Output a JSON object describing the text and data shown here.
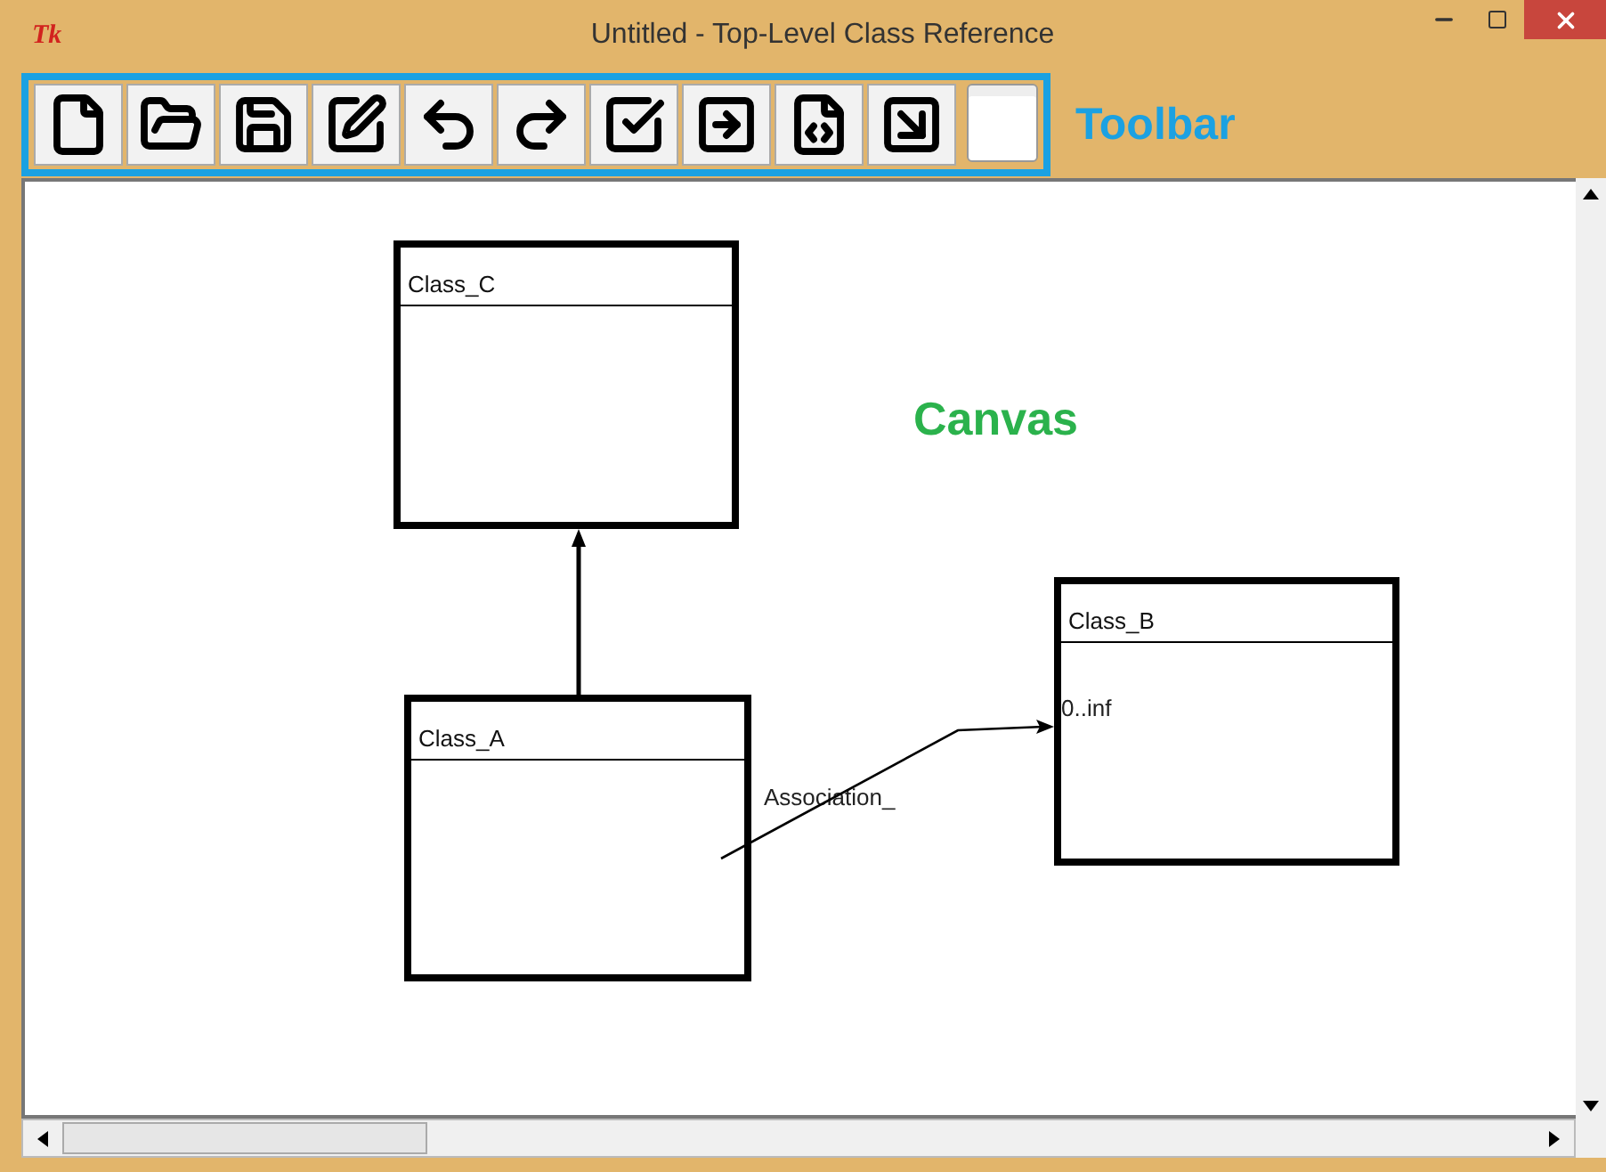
{
  "window": {
    "logo": "Tk",
    "title": "Untitled - Top-Level Class Reference"
  },
  "toolbar": {
    "caption": "Toolbar",
    "buttons": [
      {
        "kind": "new"
      },
      {
        "kind": "open"
      },
      {
        "kind": "save"
      },
      {
        "kind": "edit"
      },
      {
        "kind": "undo"
      },
      {
        "kind": "redo"
      },
      {
        "kind": "check"
      },
      {
        "kind": "export"
      },
      {
        "kind": "code"
      },
      {
        "kind": "import"
      },
      {
        "kind": "blank"
      }
    ]
  },
  "canvas": {
    "caption": "Canvas",
    "classes": [
      {
        "name": "Class_C"
      },
      {
        "name": "Class_A"
      },
      {
        "name": "Class_B"
      }
    ],
    "connectors": [
      {
        "kind": "generalization"
      },
      {
        "kind": "association",
        "label": "Association_",
        "multiplicity": "0..inf"
      }
    ]
  }
}
